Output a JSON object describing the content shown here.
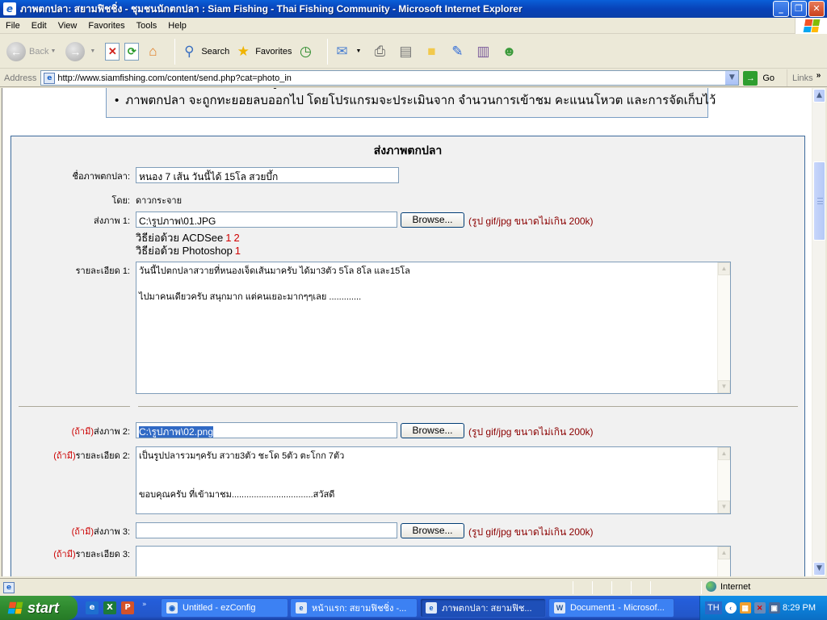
{
  "window": {
    "title": "ภาพตกปลา: สยามฟิชชิ่ง - ชุมชนนักตกปลา : Siam Fishing - Thai Fishing Community - Microsoft Internet Explorer",
    "buttons": {
      "minimize": "_",
      "restore": "❐",
      "close": "✕"
    }
  },
  "menu": [
    "File",
    "Edit",
    "View",
    "Favorites",
    "Tools",
    "Help"
  ],
  "toolbar": {
    "back_label": "Back",
    "search_label": "Search",
    "favorites_label": "Favorites"
  },
  "address": {
    "label": "Address",
    "url": "http://www.siamfishing.com/content/send.php?cat=photo_in",
    "go_label": "Go",
    "links_label": "Links"
  },
  "info_box": {
    "items": [
      "ภาพตกปลาที่ไม่เหมาะสมจะถูกลบออกโดยไม่ต้องแจ้งให้ทราบล่วงหน้า",
      "ภาพตกปลา จะถูกทะยอยลบออกไป โดยโปรแกรมจะประเมินจาก จำนวนการเข้าชม คะแนนโหวต และการจัดเก็บไว้"
    ]
  },
  "form": {
    "title": "ส่งภาพตกปลา",
    "optional_prefix": "(ถ้ามี)",
    "photo_name": {
      "label": "ชื่อภาพตกปลา:",
      "value": "หนอง 7 เส้น วันนี้ได้ 15โล สวยบึ้ก"
    },
    "by": {
      "label": "โดย:",
      "value": "ดาวกระจาย"
    },
    "browse_label": "Browse...",
    "hint": "(รูป gif/jpg ขนาดไม่เกิน 200k)",
    "resize_acdsee": {
      "label": "วิธีย่อด้วย ACDSee",
      "links": [
        "1",
        "2"
      ]
    },
    "resize_photoshop": {
      "label": "วิธีย่อด้วย Photoshop",
      "links": [
        "1"
      ]
    },
    "photos": [
      {
        "file_label": "ส่งภาพ 1:",
        "file_value": "C:\\รูปภาพ\\01.JPG",
        "detail_label": "รายละเอียด 1:",
        "detail_lines": [
          "วันนี้ไปตกปลาสวายที่หนองเจ็ดเส้นมาครับ ได้มา3ตัว 5โล 8โล และ15โล",
          "",
          "ไปมาคนเดียวครับ สนุกมาก แต่คนเยอะมากๆๆเลย ............."
        ]
      },
      {
        "file_label": "ส่งภาพ 2:",
        "file_value": "C:\\รูปภาพ\\02.png",
        "detail_label": "รายละเอียด 2:",
        "detail_lines": [
          "เป็นรูปปลารวมๆครับ สวาย3ตัว ชะโด 5ตัว ตะโกก 7ตัว",
          "",
          "",
          "ขอบคุณครับ ที่เข้ามาชม.................................สวัสดี"
        ]
      },
      {
        "file_label": "ส่งภาพ 3:",
        "file_value": "",
        "detail_label": "รายละเอียด 3:",
        "detail_lines": []
      }
    ]
  },
  "status": {
    "zone": "Internet"
  },
  "taskbar": {
    "start_label": "start",
    "tasks": [
      {
        "label": "Untitled - ezConfig",
        "active": false
      },
      {
        "label": "หน้าแรก: สยามฟิชชิ่ง -...",
        "active": false
      },
      {
        "label": "ภาพตกปลา: สยามฟิช...",
        "active": true
      },
      {
        "label": "Document1 - Microsof...",
        "active": false
      }
    ],
    "language": "TH",
    "clock": "8:29 PM"
  },
  "colors": {
    "optional_red": "#cc0000",
    "hint_darkred": "#8b0000",
    "panel_border": "#3d6a9b",
    "selection": "#316ac5"
  }
}
